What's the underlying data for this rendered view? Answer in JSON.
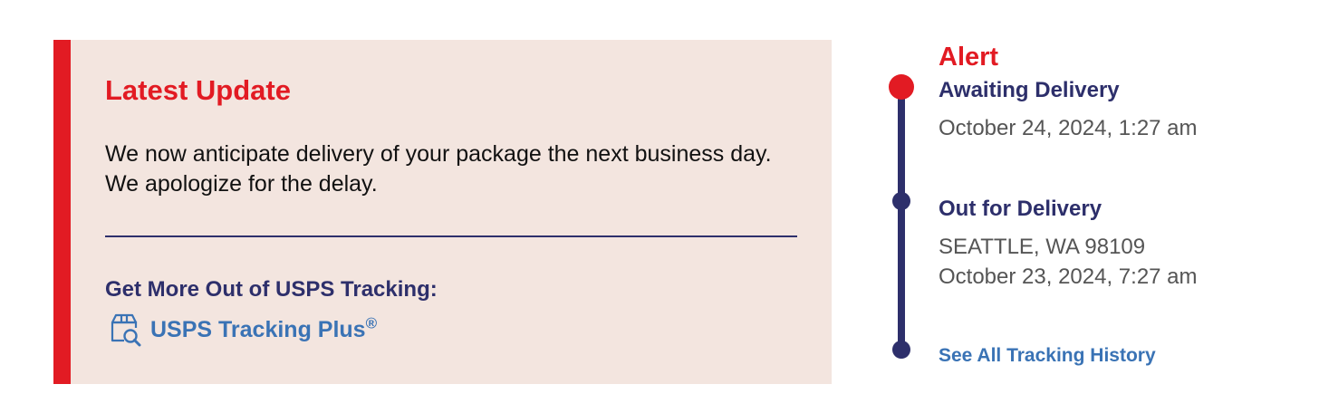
{
  "latest_update": {
    "title": "Latest Update",
    "message": "We now anticipate delivery of your package the next business day. We apologize for the delay.",
    "promo_heading": "Get More Out of USPS Tracking:",
    "promo_link_label": "USPS Tracking Plus",
    "promo_link_mark": "®",
    "promo_icon": "package-search-icon"
  },
  "timeline": {
    "alert_label": "Alert",
    "events": [
      {
        "status": "Awaiting Delivery",
        "date": "October 24, 2024, 1:27 am"
      },
      {
        "status": "Out for Delivery",
        "location": "SEATTLE, WA 98109",
        "date": "October 23, 2024, 7:27 am"
      }
    ],
    "history_link": "See All Tracking History"
  },
  "colors": {
    "alert_red": "#e21b23",
    "usps_navy": "#2d2f6b",
    "link_blue": "#3a73b5",
    "card_background": "#f3e5df"
  }
}
